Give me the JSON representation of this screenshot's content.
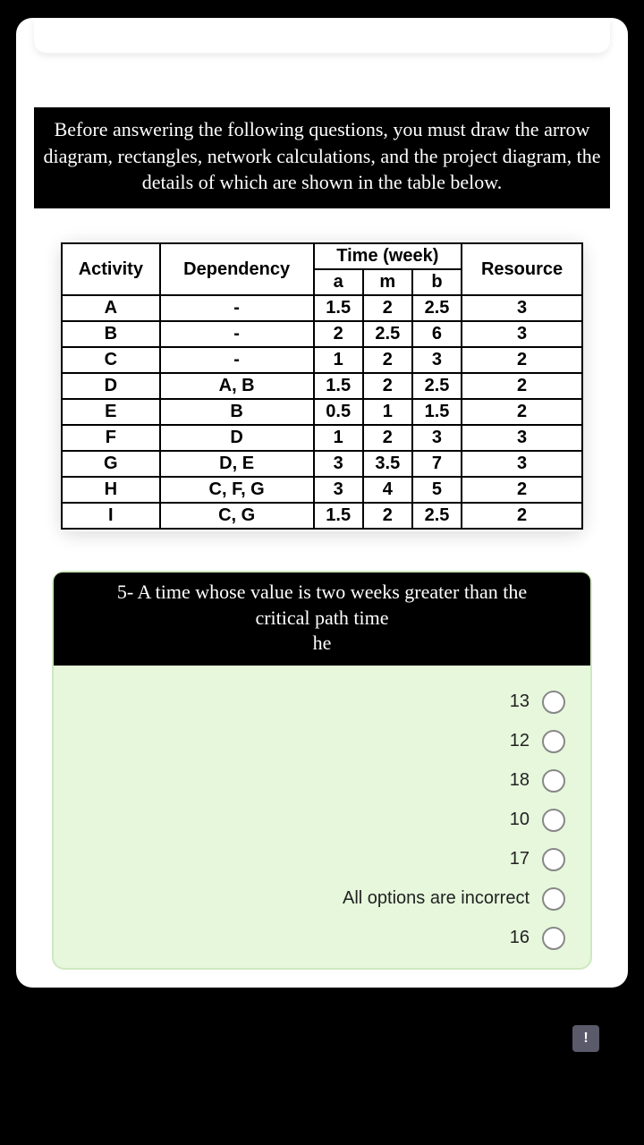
{
  "instruction": "Before answering the following questions, you must draw the arrow diagram, rectangles, network calculations, and the project diagram, the details of which are shown in the table below.",
  "table": {
    "headers": {
      "activity": "Activity",
      "dependency": "Dependency",
      "time_group": "Time (week)",
      "a": "a",
      "m": "m",
      "b": "b",
      "resource": "Resource"
    },
    "rows": [
      {
        "activity": "A",
        "dependency": "-",
        "a": "1.5",
        "m": "2",
        "b": "2.5",
        "resource": "3"
      },
      {
        "activity": "B",
        "dependency": "-",
        "a": "2",
        "m": "2.5",
        "b": "6",
        "resource": "3"
      },
      {
        "activity": "C",
        "dependency": "-",
        "a": "1",
        "m": "2",
        "b": "3",
        "resource": "2"
      },
      {
        "activity": "D",
        "dependency": "A, B",
        "a": "1.5",
        "m": "2",
        "b": "2.5",
        "resource": "2"
      },
      {
        "activity": "E",
        "dependency": "B",
        "a": "0.5",
        "m": "1",
        "b": "1.5",
        "resource": "2"
      },
      {
        "activity": "F",
        "dependency": "D",
        "a": "1",
        "m": "2",
        "b": "3",
        "resource": "3"
      },
      {
        "activity": "G",
        "dependency": "D, E",
        "a": "3",
        "m": "3.5",
        "b": "7",
        "resource": "3"
      },
      {
        "activity": "H",
        "dependency": "C, F, G",
        "a": "3",
        "m": "4",
        "b": "5",
        "resource": "2"
      },
      {
        "activity": "I",
        "dependency": "C, G",
        "a": "1.5",
        "m": "2",
        "b": "2.5",
        "resource": "2"
      }
    ]
  },
  "question": {
    "text_line1": "5- A time whose value is two weeks greater than the",
    "text_line2": "critical path time",
    "text_line3": "he",
    "options": [
      "13",
      "12",
      "18",
      "10",
      "17",
      "All options are incorrect",
      "16"
    ]
  },
  "action_icon": "!"
}
